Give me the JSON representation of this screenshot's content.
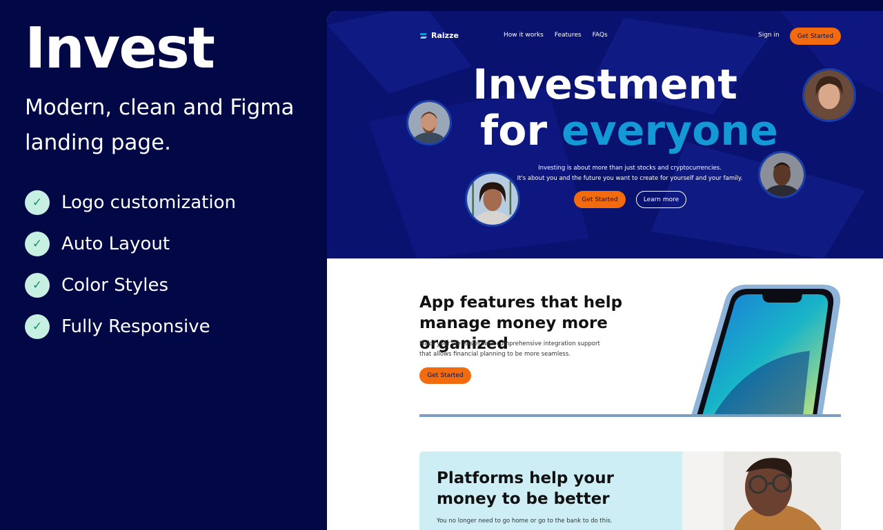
{
  "promo": {
    "title": "Invest",
    "subtitle": "Modern, clean and Figma landing page.",
    "features": [
      {
        "label": "Logo customization",
        "icon": "check-icon"
      },
      {
        "label": "Auto Layout",
        "icon": "check-icon"
      },
      {
        "label": "Color Styles",
        "icon": "check-icon"
      },
      {
        "label": "Fully Responsive",
        "icon": "check-icon"
      }
    ]
  },
  "nav": {
    "brand": "Raizze",
    "links": [
      "How it works",
      "Features",
      "FAQs"
    ],
    "signin": "Sign in",
    "cta": "Get Started"
  },
  "hero": {
    "headline_1": "Investment",
    "headline_2_plain": "for",
    "headline_2_accent": "everyone",
    "description_1": "Investing is about more than just stocks and cryptocurrencies.",
    "description_2": "It's about you and the future you want to create for yourself and your family.",
    "primary_cta": "Get Started",
    "secondary_cta": "Learn more"
  },
  "features": {
    "title": "App features that help manage money more organized",
    "description_1": "Make your life easier with comprehensive integration support",
    "description_2": "that allows financial planning to be more seamless.",
    "cta": "Get Started"
  },
  "platforms": {
    "title": "Platforms help your money to be better",
    "description": "You no longer need to go home or go to the bank to do this."
  },
  "colors": {
    "background": "#020846",
    "hero": "#0a1270",
    "accent": "#139ad6",
    "cta": "#f26b0f",
    "check": "#c8f0e2"
  }
}
